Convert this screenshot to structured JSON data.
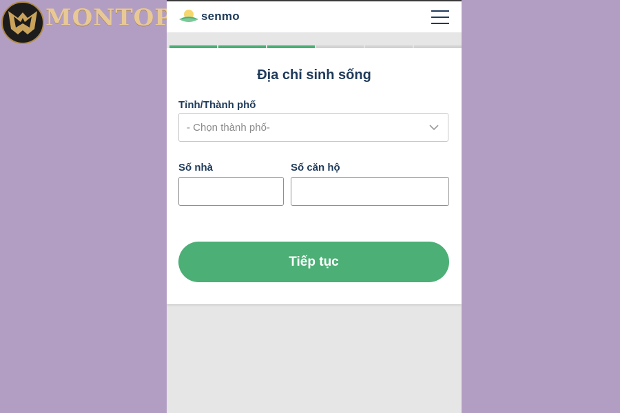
{
  "watermark": {
    "text": "MONTOP"
  },
  "header": {
    "brand": "senmo",
    "menu_icon": "hamburger-menu-icon"
  },
  "progress": {
    "segments_total": 6,
    "segments_done": 3,
    "done_color": "#4caf76",
    "todo_color": "#d4d4d4"
  },
  "form": {
    "title": "Địa chỉ sinh sống",
    "city": {
      "label": "Tỉnh/Thành phố",
      "placeholder": "- Chọn thành phố-",
      "icon": "chevron-down-icon"
    },
    "house_number": {
      "label": "Số nhà",
      "value": ""
    },
    "apartment_number": {
      "label": "Số căn hộ",
      "value": ""
    },
    "submit_label": "Tiếp tục"
  },
  "colors": {
    "accent": "#4caf76",
    "heading": "#1e3a5a",
    "backdrop": "#b39ec3"
  }
}
